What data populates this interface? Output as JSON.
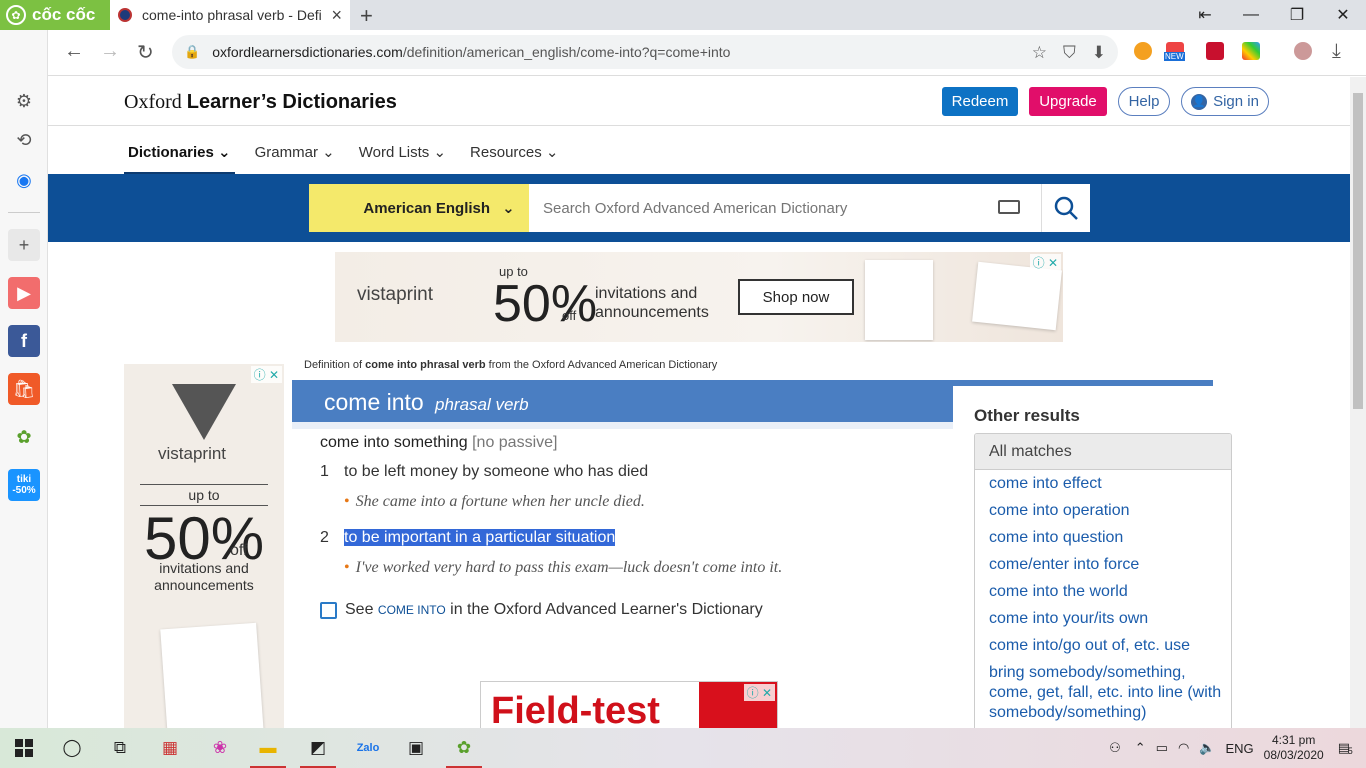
{
  "browser": {
    "brand": "cốc cốc",
    "tab_title": "come-into phrasal verb - Defi",
    "url_host": "oxfordlearnersdictionaries.com",
    "url_path": "/definition/american_english/come-into?q=come+into",
    "ext_new_badge": "NEW"
  },
  "sidebar": {
    "tiki_label": "tiki",
    "tiki_badge": "-50%"
  },
  "site": {
    "logo_plain": "Oxford ",
    "logo_bold": "Learner’s Dictionaries",
    "redeem": "Redeem",
    "upgrade": "Upgrade",
    "help": "Help",
    "signin": "Sign in",
    "nav": [
      "Dictionaries",
      "Grammar",
      "Word Lists",
      "Resources"
    ],
    "dictionary_select": "American English",
    "search_placeholder": "Search Oxford Advanced American Dictionary"
  },
  "banner_ad": {
    "brand": "vistaprint",
    "up_to": "up to",
    "percent": "50%",
    "off": "off",
    "text_line1": "invitations and",
    "text_line2": "announcements",
    "cta": "Shop now"
  },
  "side_ad": {
    "brand": "vistaprint",
    "up_to": "up to",
    "percent": "50%",
    "off": "off",
    "text_line1": "invitations and",
    "text_line2": "announcements"
  },
  "bottom_ad": {
    "text": "Field-test"
  },
  "entry": {
    "note_pre": "Definition of ",
    "note_bold": "come into phrasal verb",
    "note_post": " from the Oxford Advanced American Dictionary",
    "headword": "come into",
    "pos": "phrasal verb",
    "idiom": "come into something",
    "idiom_label": "[no passive]",
    "senses": [
      {
        "num": "1",
        "def": "to be left money by someone who has died",
        "example": "She came into a fortune when her uncle died."
      },
      {
        "num": "2",
        "def": "to be important in a particular situation",
        "example": "I've worked very hard to pass this exam—luck doesn't come into it."
      }
    ],
    "see_pre": "See ",
    "see_link": "come into",
    "see_post": " in the Oxford Advanced Learner's Dictionary"
  },
  "other_results": {
    "heading": "Other results",
    "tab": "All matches",
    "items": [
      "come into effect",
      "come into operation",
      "come into question",
      "come/enter into force",
      "come into the world",
      "come into your/its own",
      "come into/go out of, etc. use",
      "bring somebody/something, come, get, fall, etc. into line (with somebody/something)"
    ]
  },
  "taskbar": {
    "lang": "ENG",
    "time": "4:31 pm",
    "date": "08/03/2020",
    "notif_count": "5"
  }
}
